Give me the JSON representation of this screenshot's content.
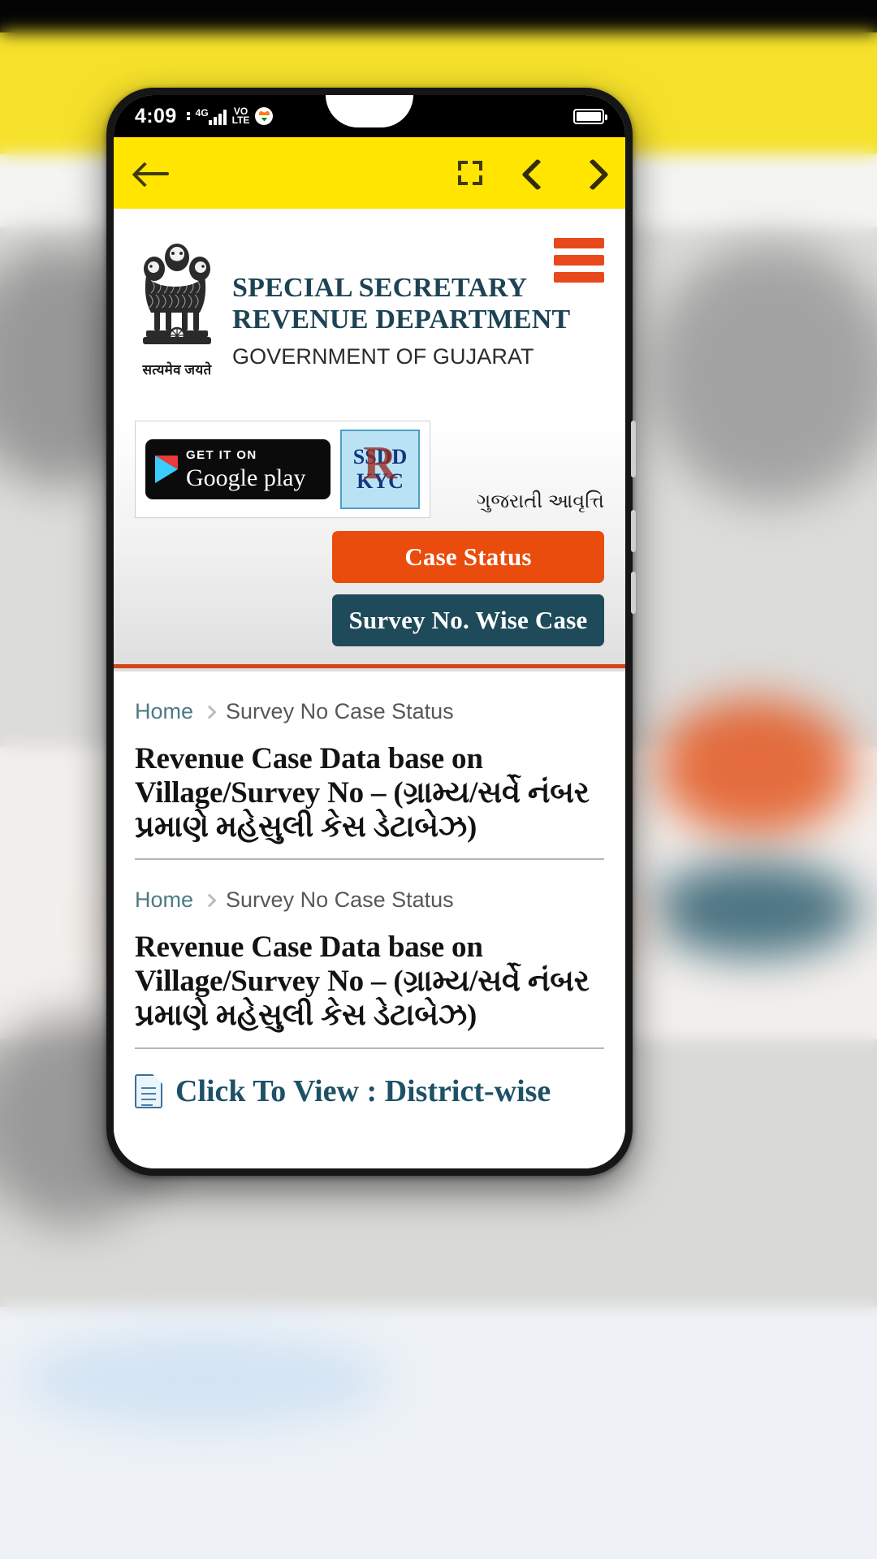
{
  "status_bar": {
    "time": "4:09",
    "network": "4G",
    "volte": "VO\nLTE",
    "volte_top": "VO",
    "volte_bottom": "LTE",
    "carrier_badge_icon": "indian-flag-heart-icon",
    "battery_icon": "battery-full-icon"
  },
  "toolbar": {
    "back_icon": "back-arrow-icon",
    "fullscreen_icon": "fullscreen-icon",
    "prev_icon": "chevron-left-icon",
    "next_icon": "chevron-right-icon",
    "background_color": "#ffe500"
  },
  "site_header": {
    "emblem_icon": "india-state-emblem-icon",
    "emblem_motto": "सत्यमेव जयते",
    "title_line1": "SPECIAL SECRETARY",
    "title_line2": "REVENUE DEPARTMENT",
    "subtitle": "GOVERNMENT OF GUJARAT",
    "title_color": "#1d4354",
    "menu_icon": "hamburger-menu-icon",
    "menu_color": "#e8491c"
  },
  "badges": {
    "google_play": {
      "small_text": "GET IT ON",
      "big_text": "Google play",
      "icon": "google-play-icon"
    },
    "ssrd_kyc": {
      "line1": "SSDD",
      "line2": "KYC",
      "overlay_letter": "R",
      "icon": "ssrd-kyc-logo-icon"
    },
    "language_link": "ગુજરાતી આવૃત્તિ"
  },
  "action_buttons": [
    {
      "label": "Case Status",
      "color": "#ea4c0d"
    },
    {
      "label": "Survey No. Wise Case",
      "color": "#1e4a5a"
    }
  ],
  "sections": [
    {
      "breadcrumb_home": "Home",
      "breadcrumb_current": "Survey No Case Status",
      "heading": "Revenue Case Data base on Village/Survey No – (ગ્રામ્ય/સર્વે નંબર પ્રમાણે મહેસુલી કેસ ડેટાબેઝ)"
    },
    {
      "breadcrumb_home": "Home",
      "breadcrumb_current": "Survey No Case Status",
      "heading": "Revenue Case Data base on Village/Survey No – (ગ્રામ્ય/સર્વે નંબર પ્રમાણે મહેસુલી કેસ ડેટાબેઝ)"
    }
  ],
  "view_link": {
    "icon": "document-icon",
    "label": "Click To View : District-wise"
  }
}
